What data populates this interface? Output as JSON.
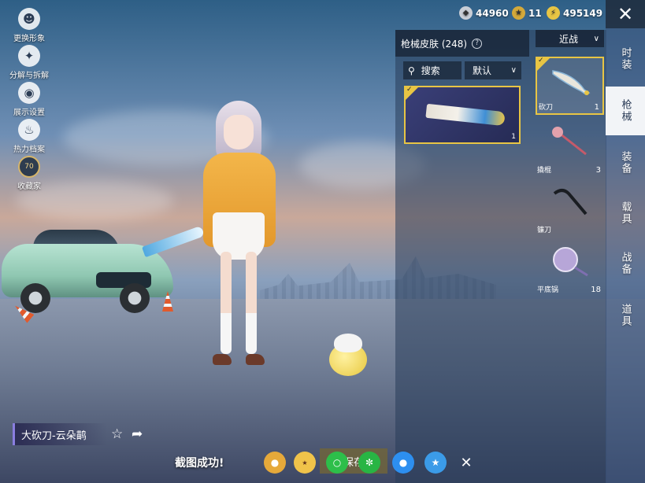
{
  "left_menu": {
    "items": [
      {
        "label": "更换形象",
        "icon": "person-icon"
      },
      {
        "label": "分解与拆解",
        "icon": "puzzle-icon"
      },
      {
        "label": "展示设置",
        "icon": "eye-icon"
      },
      {
        "label": "热力档案",
        "icon": "fire-icon"
      },
      {
        "label": "收藏家",
        "icon": "collector-badge-icon",
        "badge": "70"
      }
    ]
  },
  "currency": {
    "silver": "44960",
    "coupon": "11",
    "gold": "495149"
  },
  "skin_panel": {
    "title": "枪械皮肤 (248)",
    "search_label": "搜索",
    "sort_label": "默认",
    "cards": [
      {
        "count": "1",
        "selected": true
      }
    ]
  },
  "weapon_panel": {
    "filter": "近战",
    "items": [
      {
        "name": "砍刀",
        "count": "1",
        "selected": true
      },
      {
        "name": "撬棍",
        "count": "3"
      },
      {
        "name": "镰刀",
        "count": ""
      },
      {
        "name": "平底锅",
        "count": "18"
      }
    ]
  },
  "tabs": [
    {
      "label": "时装",
      "active": false
    },
    {
      "label": "枪械",
      "active": true
    },
    {
      "label": "装备",
      "active": false
    },
    {
      "label": "载具",
      "active": false
    },
    {
      "label": "战备",
      "active": false
    },
    {
      "label": "道具",
      "active": false
    }
  ],
  "skin_name": "大砍刀-云朵鹋",
  "bottom": {
    "toast": "截图成功!",
    "save_label": "保存"
  },
  "colors": {
    "accent": "#e8c544",
    "tab_active_bg": "#f2f4f7"
  }
}
